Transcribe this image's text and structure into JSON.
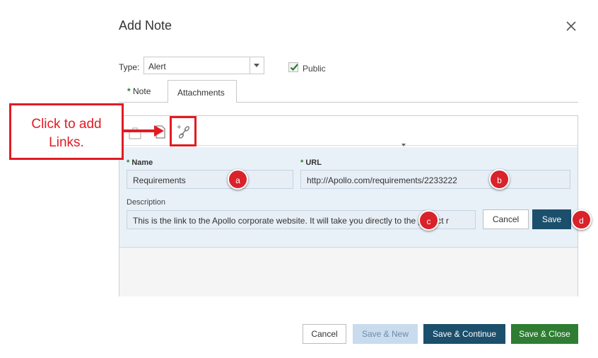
{
  "dialog": {
    "title": "Add Note",
    "close_icon": "close-icon"
  },
  "type_field": {
    "label": "Type:",
    "value": "Alert"
  },
  "public": {
    "label": "Public",
    "checked": true
  },
  "tabs": [
    {
      "required_mark": "*",
      "label": "Note",
      "active": false
    },
    {
      "label": "Attachments",
      "active": true
    }
  ],
  "toolbar": {
    "icons": [
      "delete-icon",
      "add-file-icon",
      "add-link-icon"
    ]
  },
  "link_form": {
    "name_required": "*",
    "name_label": "Name",
    "name_value": "Requirements",
    "url_required": "*",
    "url_label": "URL",
    "url_value": "http://Apollo.com/requirements/2233222",
    "description_label": "Description",
    "description_value": "This is the link to the Apollo corporate website. It will take you directly to the project r",
    "cancel_label": "Cancel",
    "save_label": "Save"
  },
  "annotations": {
    "callout_line1": "Click to add",
    "callout_line2": "Links.",
    "badges": [
      "a",
      "b",
      "c",
      "d"
    ],
    "color": "#e21b23"
  },
  "footer": {
    "cancel_label": "Cancel",
    "save_new_label": "Save & New",
    "save_continue_label": "Save & Continue",
    "save_close_label": "Save & Close"
  },
  "colors": {
    "primary_dark": "#1b4f6b",
    "success": "#2e7d32",
    "disabled": "#c9dcee",
    "form_background": "#e9f1f8"
  }
}
